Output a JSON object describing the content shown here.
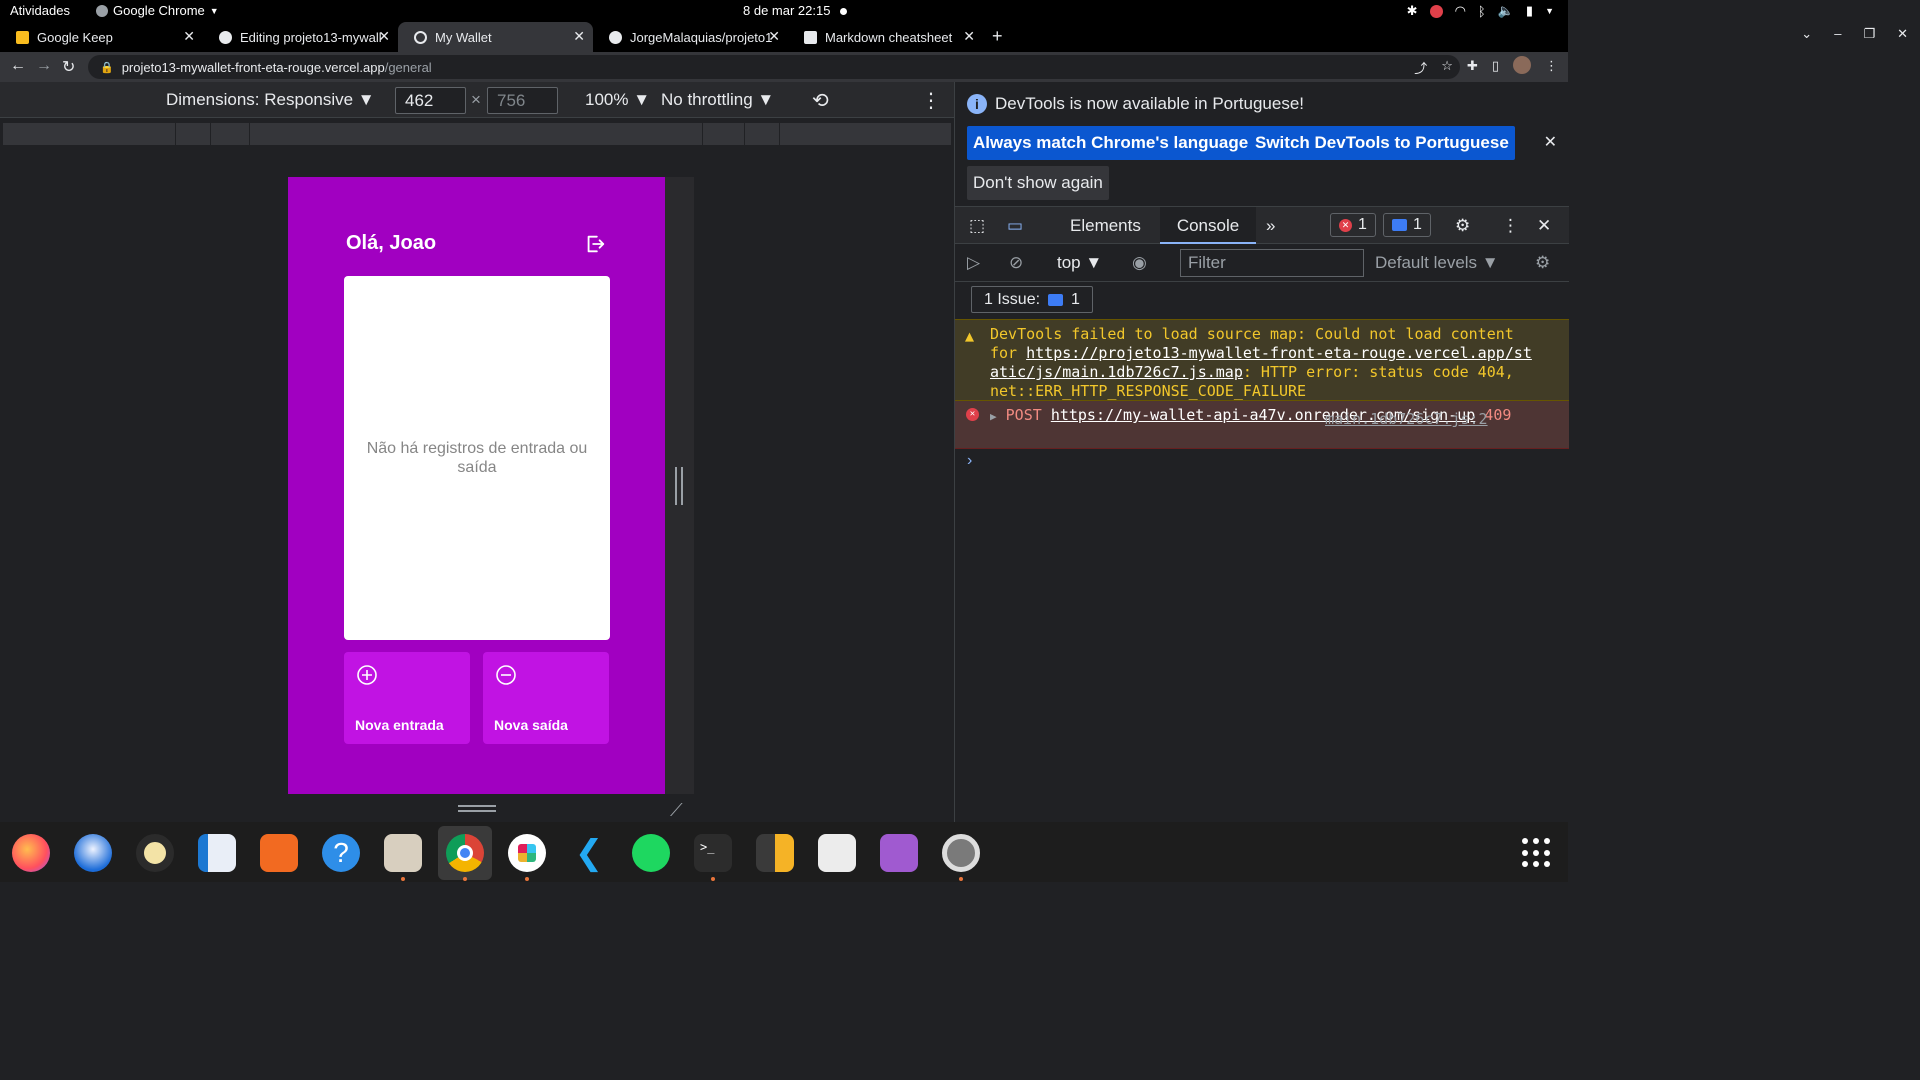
{
  "system_bar": {
    "activities": "Atividades",
    "app_name": "Google Chrome",
    "clock": "8 de mar  22:15"
  },
  "tabs": [
    {
      "label": "Google Keep",
      "favicon_color": "#f9bc1f"
    },
    {
      "label": "Editing projeto13-mywall",
      "favicon_color": "#e8eaed"
    },
    {
      "label": "My Wallet",
      "favicon_color": "#e8eaed"
    },
    {
      "label": "JorgeMalaquias/projeto1",
      "favicon_color": "#e8eaed"
    },
    {
      "label": "Markdown cheatsheet",
      "favicon_color": "#e8eaed"
    }
  ],
  "address_bar": {
    "host": "projeto13-mywallet-front-eta-rouge.vercel.app",
    "path": "/general"
  },
  "device_toolbar": {
    "dimensions": "Dimensions: Responsive ▼",
    "width": "462",
    "height": "756",
    "zoom": "100% ▼",
    "throttling": "No throttling ▼"
  },
  "app": {
    "greeting": "Olá, Joao",
    "empty_message": "Não há registros de entrada ou saída",
    "income_button": "Nova entrada",
    "expense_button": "Nova saída",
    "colors": {
      "background": "#a100c1",
      "buttons": "#c113e3"
    }
  },
  "devtools": {
    "info_message": "DevTools is now available in Portuguese!",
    "btn_match": "Always match Chrome's language",
    "btn_switch": "Switch DevTools to Portuguese",
    "btn_dont_show": "Don't show again",
    "tab_elements": "Elements",
    "tab_console": "Console",
    "error_count": "1",
    "message_count": "1",
    "context": "top ▼",
    "filter_placeholder": "Filter",
    "levels": "Default levels ▼",
    "issues_label": "1 Issue:",
    "issues_count": "1",
    "warning": {
      "prefix": "DevTools failed to load source map: Could not load content for ",
      "link": "https://projeto13-mywallet-front-eta-rouge.vercel.app/static/js/main.1db726c7.js.map",
      "suffix": ": HTTP error: status code 404, net::ERR_HTTP_RESPONSE_CODE_FAILURE"
    },
    "error": {
      "method": "POST",
      "link": "https://my-wallet-api-a47v.onrender.com/sign-up",
      "status": "409",
      "source": "main.1db726c7.js:2"
    }
  },
  "dock_apps": [
    "firefox-icon",
    "thunderbird-icon",
    "rhythmbox-icon",
    "writer-icon",
    "software-icon",
    "help-icon",
    "files-icon",
    "chrome-icon",
    "slack-icon",
    "vscode-icon",
    "spotify-icon",
    "terminal-icon",
    "calculator-icon",
    "document-viewer-icon",
    "video-icon",
    "settings-icon"
  ]
}
